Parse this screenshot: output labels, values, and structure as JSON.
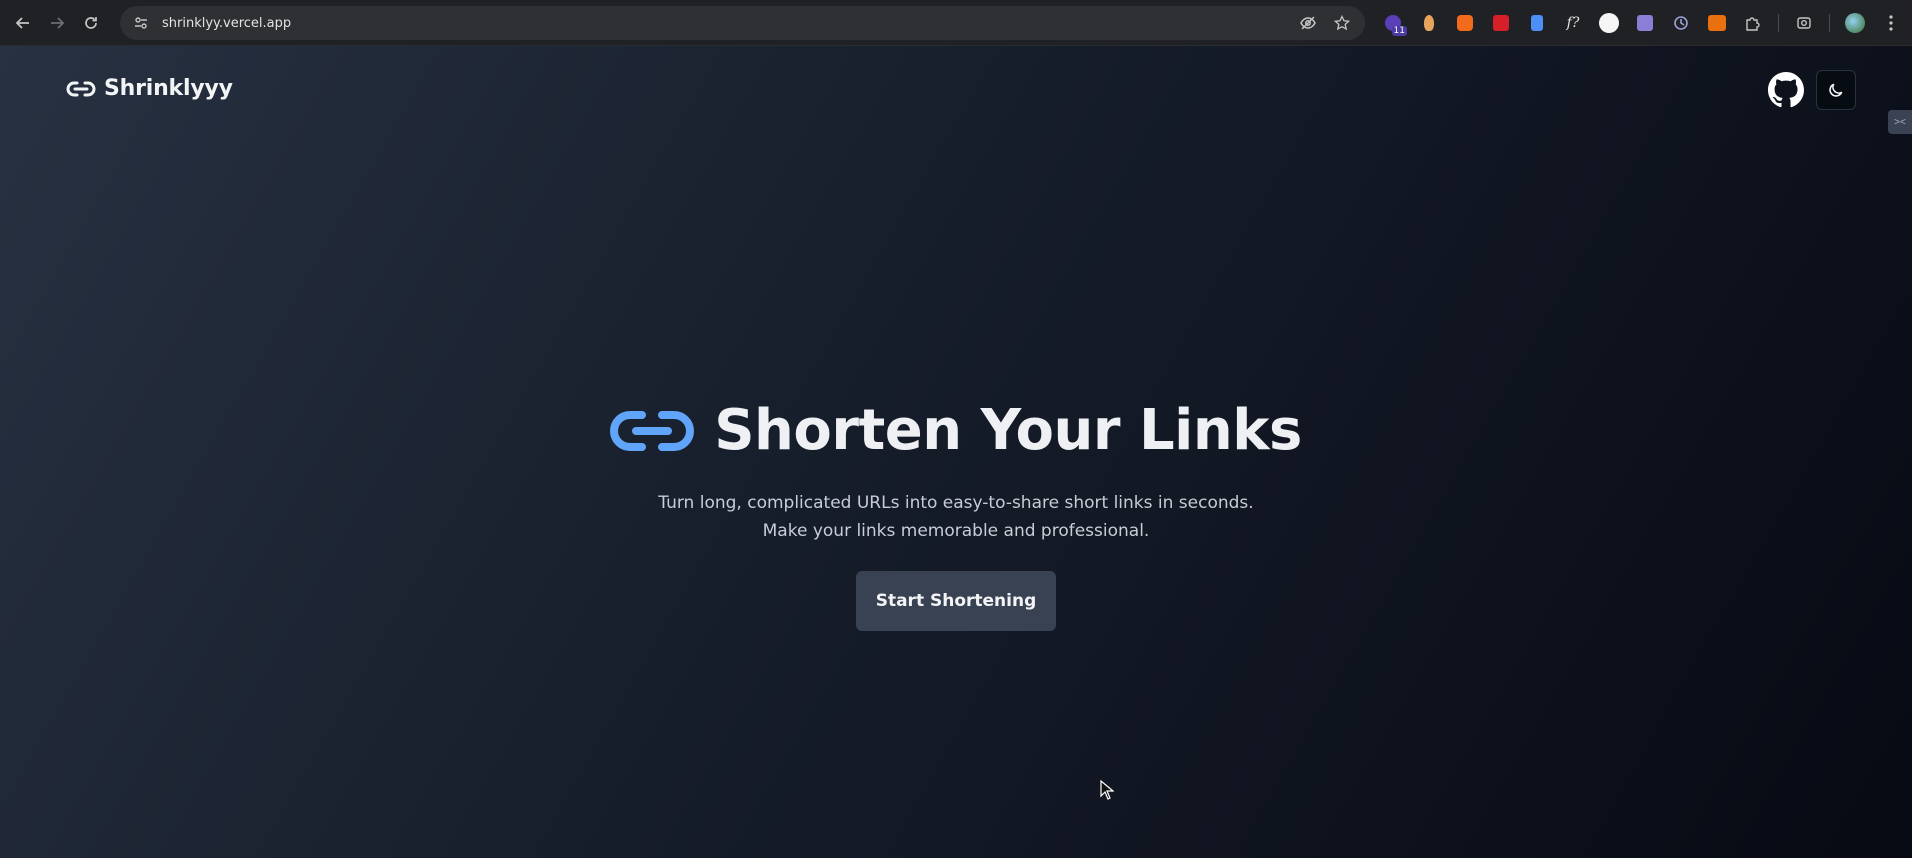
{
  "browser": {
    "url": "shrinklyy.vercel.app",
    "extension_badge": "11",
    "icons": [
      "back-arrow-icon",
      "forward-arrow-icon",
      "reload-icon",
      "site-info-icon",
      "eye-off-icon",
      "star-icon",
      "extensions-puzzle-icon",
      "screenshot-icon",
      "more-vert-icon"
    ]
  },
  "header": {
    "brand_name": "Shrinklyyy",
    "github_icon": "github-icon",
    "theme_icon": "moon-icon"
  },
  "hero": {
    "title": "Shorten Your Links",
    "subtitle_line1": "Turn long, complicated URLs into easy-to-share short links in seconds.",
    "subtitle_line2": "Make your links memorable and professional.",
    "cta_label": "Start Shortening",
    "link_icon_color": "#60a5fa"
  },
  "colors": {
    "background_start": "#273141",
    "background_end": "#070a13",
    "button_bg": "#394253"
  }
}
